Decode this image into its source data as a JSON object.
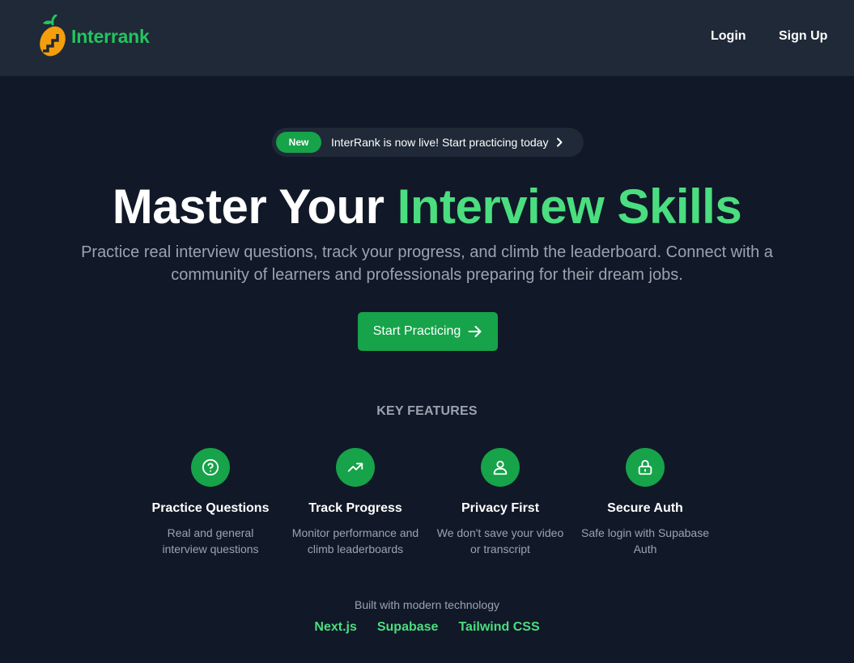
{
  "nav": {
    "brand": "Interrank",
    "login_label": "Login",
    "signup_label": "Sign Up"
  },
  "announcement": {
    "badge": "New",
    "text": "InterRank is now live! Start practicing today"
  },
  "hero": {
    "title_part1": "Master Your",
    "title_part2": "Interview Skills",
    "subtitle": "Practice real interview questions, track your progress, and climb the leaderboard. Connect with a community of learners and professionals preparing for their dream jobs.",
    "cta_label": "Start Practicing"
  },
  "features": {
    "heading": "KEY FEATURES",
    "items": [
      {
        "icon": "question-circle-icon",
        "title": "Practice Questions",
        "description": "Real and general interview questions"
      },
      {
        "icon": "trending-up-icon",
        "title": "Track Progress",
        "description": "Monitor performance and climb leaderboards"
      },
      {
        "icon": "user-icon",
        "title": "Privacy First",
        "description": "We don't save your video or transcript"
      },
      {
        "icon": "lock-icon",
        "title": "Secure Auth",
        "description": "Safe login with Supabase Auth"
      }
    ]
  },
  "tech": {
    "label": "Built with modern technology",
    "items": [
      "Next.js",
      "Supabase",
      "Tailwind CSS"
    ]
  },
  "colors": {
    "background": "#111827",
    "navbar": "#1f2937",
    "accent": "#16a34a",
    "accent_light": "#4ade80",
    "muted_text": "#9ca3af"
  }
}
